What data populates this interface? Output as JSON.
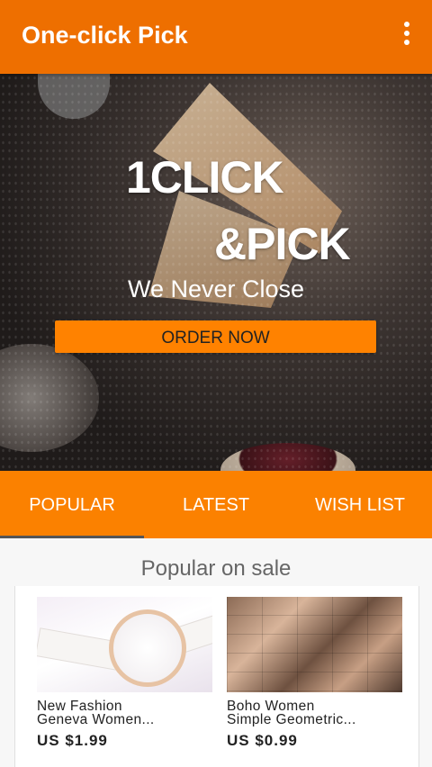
{
  "appbar": {
    "title": "One-click Pick",
    "menu_icon": "more-vert-icon"
  },
  "hero": {
    "line1": "1CLICK",
    "line2": "&PICK",
    "tagline": "We Never Close",
    "button_label": "ORDER NOW"
  },
  "tabs": [
    {
      "label": "POPULAR",
      "selected": true
    },
    {
      "label": "LATEST",
      "selected": false
    },
    {
      "label": "WISH LIST",
      "selected": false
    }
  ],
  "section_title": "Popular on sale",
  "products": [
    {
      "name_line1": "New Fashion",
      "name_line2": "Geneva Women...",
      "price": "US $1.99",
      "image": "watch-image"
    },
    {
      "name_line1": "Boho Women",
      "name_line2": "Simple Geometric...",
      "price": "US $0.99",
      "image": "jewelry-image"
    }
  ],
  "colors": {
    "appbar": "#ee6f00",
    "tabs": "#fb8100",
    "button": "#ff8200"
  }
}
